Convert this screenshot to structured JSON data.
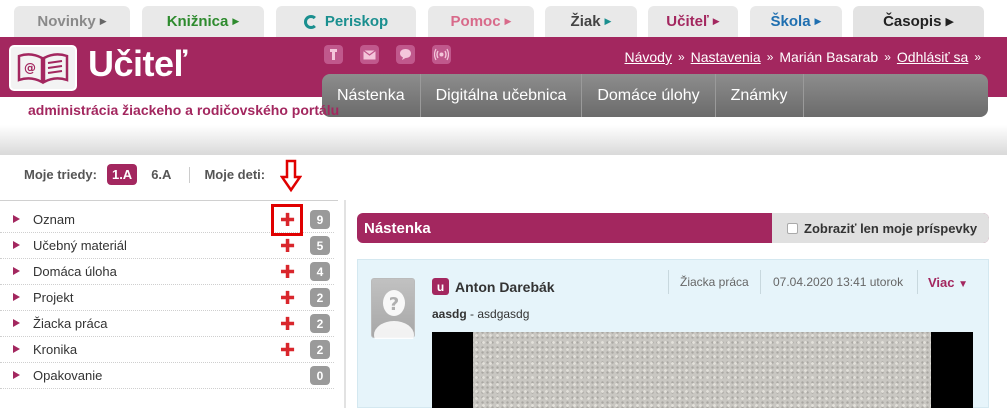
{
  "top_tabs": [
    {
      "label": "Novinky",
      "color": "#8a8a8a"
    },
    {
      "label": "Knižnica",
      "color": "#2e8b2e"
    },
    {
      "label": "Periskop",
      "color": "#1a8f8f"
    },
    {
      "label": "Pomoc",
      "color": "#d86a8a"
    },
    {
      "label": "Žiak",
      "color": "#444444"
    },
    {
      "label": "Učiteľ",
      "color": "#a3275f"
    },
    {
      "label": "Škola",
      "color": "#1f6fb0"
    },
    {
      "label": "Časopis",
      "color": "#222222"
    }
  ],
  "header": {
    "title": "Učiteľ",
    "tagline": "administrácia žiackeho a rodičovského portálu",
    "links": {
      "navody": "Návody",
      "nastavenia": "Nastavenia",
      "user": "Marián Basarab",
      "logout": "Odhlásiť sa"
    },
    "brand_color": "#a3275f"
  },
  "nav": [
    "Nástenka",
    "Digitálna učebnica",
    "Domáce úlohy",
    "Známky"
  ],
  "classes": {
    "label": "Moje triedy:",
    "items": [
      "1.A",
      "6.A"
    ],
    "kids_label": "Moje deti:"
  },
  "sidebar": [
    {
      "label": "Oznam",
      "count": "9"
    },
    {
      "label": "Učebný materiál",
      "count": "5"
    },
    {
      "label": "Domáca úloha",
      "count": "4"
    },
    {
      "label": "Projekt",
      "count": "2"
    },
    {
      "label": "Žiacka práca",
      "count": "2"
    },
    {
      "label": "Kronika",
      "count": "2"
    },
    {
      "label": "Opakovanie",
      "count": "0"
    }
  ],
  "board": {
    "title": "Nástenka",
    "filter": "Zobraziť len moje príspevky"
  },
  "post": {
    "badge": "u",
    "author": "Anton Darebák",
    "type": "Žiacka práca",
    "date": "07.04.2020 13:41 utorok",
    "more": "Viac",
    "text_bold": "aasdg",
    "text_rest": " - asdgasdg"
  }
}
